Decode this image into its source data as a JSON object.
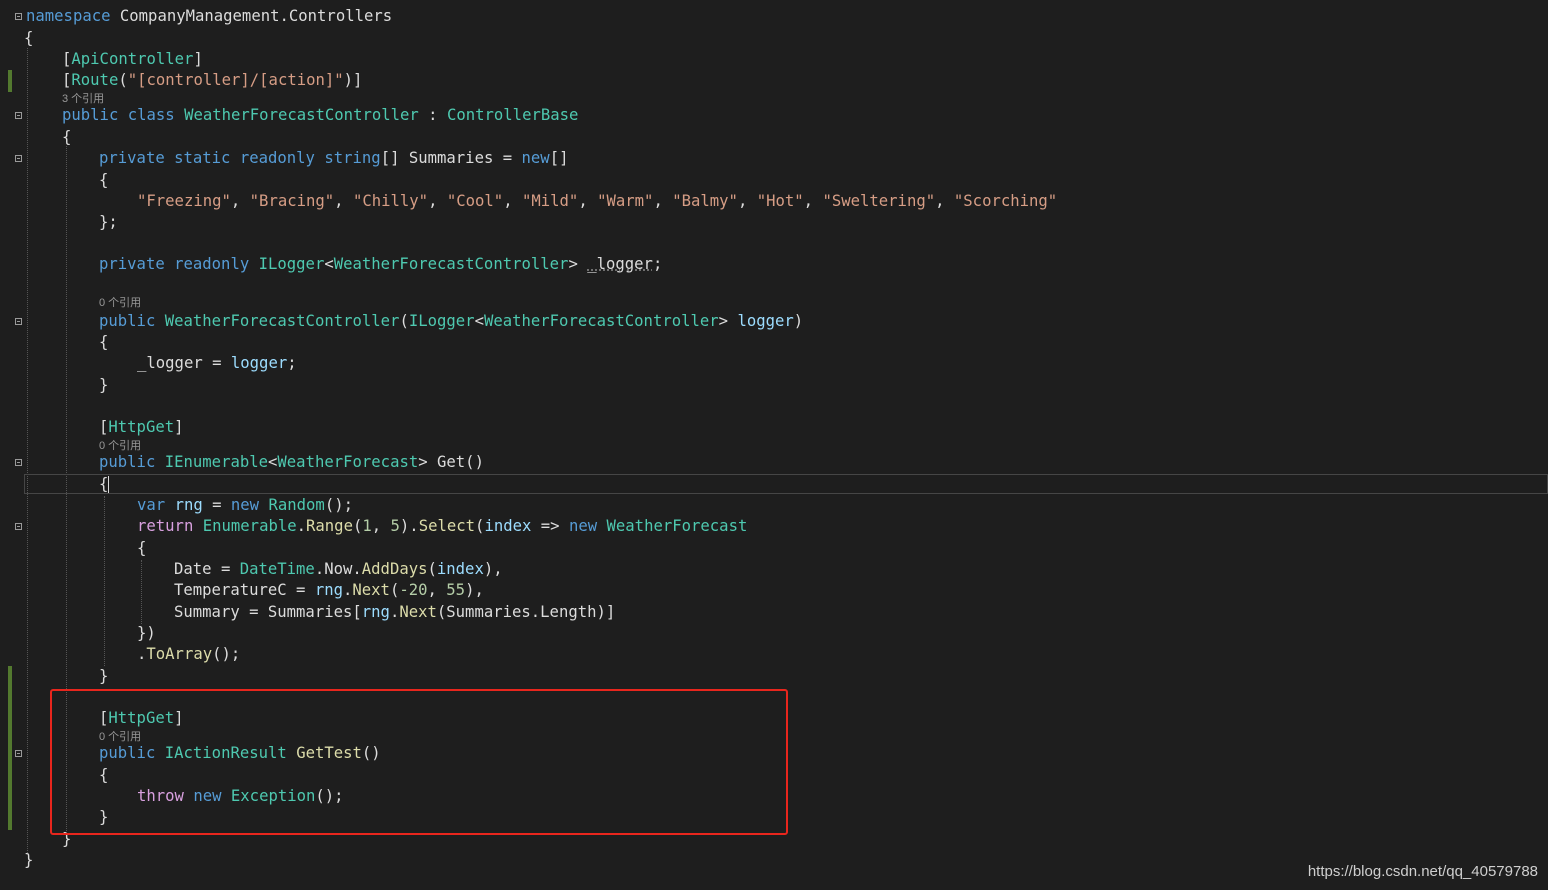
{
  "code": {
    "l01": {
      "kw": "namespace",
      "rest": " CompanyManagement.Controllers"
    },
    "l02": "{",
    "l03": {
      "a": "[",
      "b": "ApiController",
      "c": "]"
    },
    "l04": {
      "a": "[",
      "b": "Route",
      "c": "(",
      "d": "\"[controller]/[action]\"",
      "e": ")]"
    },
    "l05_hint": "3 个引用",
    "l05": {
      "a": "public",
      "b": " ",
      "c": "class",
      "d": " ",
      "e": "WeatherForecastController",
      "f": " : ",
      "g": "ControllerBase"
    },
    "l06": "{",
    "l07": {
      "a": "private",
      "b": "static",
      "c": "readonly",
      "d": "string",
      "e": "[] Summaries = ",
      "f": "new",
      "g": "[]"
    },
    "l08": "{",
    "l09": {
      "s1": "\"Freezing\"",
      "s2": "\"Bracing\"",
      "s3": "\"Chilly\"",
      "s4": "\"Cool\"",
      "s5": "\"Mild\"",
      "s6": "\"Warm\"",
      "s7": "\"Balmy\"",
      "s8": "\"Hot\"",
      "s9": "\"Sweltering\"",
      "s10": "\"Scorching\"",
      "sep": ", "
    },
    "l10": "};",
    "l11": {
      "a": "private",
      "b": "readonly",
      "c": "ILogger",
      "d": "<",
      "e": "WeatherForecastController",
      "f": "> ",
      "g": "_logger",
      "h": ";"
    },
    "l12_hint": "0 个引用",
    "l12": {
      "a": "public",
      "b": "WeatherForecastController",
      "c": "(",
      "d": "ILogger",
      "e": "<",
      "f": "WeatherForecastController",
      "g": "> ",
      "h": "logger",
      "i": ")"
    },
    "l13": "{",
    "l14": {
      "a": "_logger = ",
      "b": "logger",
      "c": ";"
    },
    "l15": "}",
    "l16": {
      "a": "[",
      "b": "HttpGet",
      "c": "]"
    },
    "l17_hint": "0 个引用",
    "l17": {
      "a": "public",
      "b": "IEnumerable",
      "c": "<",
      "d": "WeatherForecast",
      "e": "> Get()"
    },
    "l18": "{",
    "l19": {
      "a": "var",
      "b": " ",
      "c": "rng",
      "d": " = ",
      "e": "new",
      "f": " ",
      "g": "Random",
      "h": "();"
    },
    "l20": {
      "a": "return",
      "b": "Enumerable",
      "c": ".",
      "d": "Range",
      "e": "(",
      "f": "1",
      "g": ", ",
      "h": "5",
      "i": ").",
      "j": "Select",
      "k": "(",
      "l": "index",
      "m": " => ",
      "n": "new",
      "o": " ",
      "p": "WeatherForecast"
    },
    "l21": "{",
    "l22": {
      "a": "Date = ",
      "b": "DateTime",
      "c": ".",
      "d": "Now",
      "e": ".",
      "f": "AddDays",
      "g": "(",
      "h": "index",
      "i": "),"
    },
    "l23": {
      "a": "TemperatureC = ",
      "b": "rng",
      "c": ".",
      "d": "Next",
      "e": "(",
      "f": "-20",
      "g": ", ",
      "h": "55",
      "i": "),"
    },
    "l24": {
      "a": "Summary = Summaries[",
      "b": "rng",
      "c": ".",
      "d": "Next",
      "e": "(Summaries.Length)]"
    },
    "l25": "})",
    "l26": {
      "a": ".",
      "b": "ToArray",
      "c": "();"
    },
    "l27": "}",
    "l28": {
      "a": "[",
      "b": "HttpGet",
      "c": "]"
    },
    "l29_hint": "0 个引用",
    "l29": {
      "a": "public",
      "b": "IActionResult",
      "c": " ",
      "d": "GetTest",
      "e": "()"
    },
    "l30": "{",
    "l31": {
      "a": "throw",
      "b": " ",
      "c": "new",
      "d": " ",
      "e": "Exception",
      "f": "();"
    },
    "l32": "}",
    "l33": "}",
    "l34": "}"
  },
  "watermark": "https://blog.csdn.net/qq_40579788",
  "colors": {
    "keyword": "#569cd6",
    "type": "#4ec9b0",
    "string": "#d69d85",
    "number": "#b5cea8",
    "control": "#d8a0df",
    "highlight_box": "#e8261d"
  }
}
